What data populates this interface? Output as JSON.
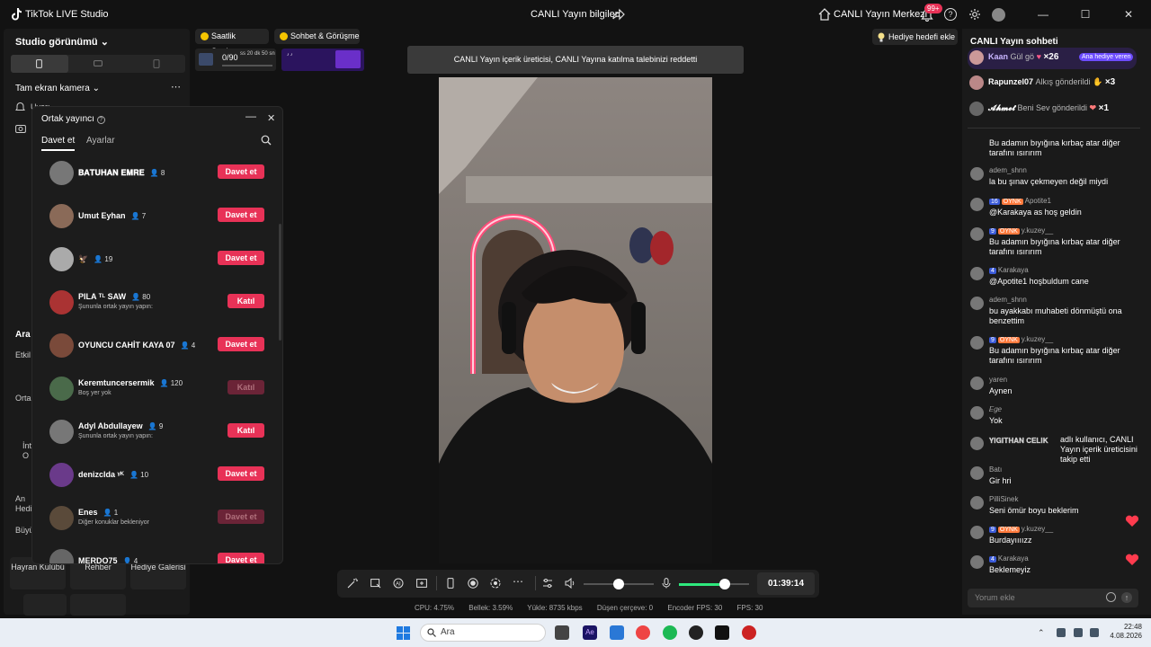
{
  "titlebar": {
    "app_title": "TikTok LIVE Studio",
    "center_title": "CANLI Yayın bilgileri",
    "live_center": "CANLI Yayın Merkezi",
    "notif_badge": "99+"
  },
  "left": {
    "studio_view": "Studio görünümü",
    "camera": "Tam ekran kamera",
    "hidden_row": "Uyarı",
    "label_ara": "Ara",
    "label_etkil": "Etkil",
    "label_orta": "Orta",
    "label_int": "İnt\nO",
    "label_an": "An\nHedi",
    "label_buy": "Büyü",
    "buttons": [
      "Hayran Kulübü",
      "Rehber",
      "Hediye Galerisi"
    ]
  },
  "cohost": {
    "title": "Ortak yayıncı",
    "tab_invite": "Davet et",
    "tab_settings": "Ayarlar",
    "rows": [
      {
        "name": "𝐁𝐀𝐓𝐔𝐇𝐀𝐍 𝐄𝐌𝐑𝐄",
        "count": "8",
        "sub": "",
        "button": "Davet et",
        "kind": "invite",
        "disabled": false
      },
      {
        "name": "Umut Eyhan",
        "count": "7",
        "sub": "",
        "button": "Davet et",
        "kind": "invite",
        "disabled": false
      },
      {
        "name": "🦅",
        "count": "19",
        "sub": "",
        "button": "Davet et",
        "kind": "invite",
        "disabled": false
      },
      {
        "name": "PILA ᵀᴸ SAW",
        "count": "80",
        "sub": "Şununla ortak yayın yapın:",
        "button": "Katıl",
        "kind": "join",
        "disabled": false
      },
      {
        "name": "OYUNCU CAHİT KAYA 07",
        "count": "4",
        "sub": "",
        "button": "Davet et",
        "kind": "invite",
        "disabled": false
      },
      {
        "name": "Keremtuncersermik",
        "count": "120",
        "sub": "Boş yer yok",
        "button": "Katıl",
        "kind": "join",
        "disabled": true
      },
      {
        "name": "Adyl Abdullayew",
        "count": "9",
        "sub": "Şununla ortak yayın yapın:",
        "button": "Katıl",
        "kind": "join",
        "disabled": false
      },
      {
        "name": "denizclda ᵞᴷ",
        "count": "10",
        "sub": "",
        "button": "Davet et",
        "kind": "invite",
        "disabled": false
      },
      {
        "name": "Enes",
        "count": "1",
        "sub": "Diğer konuklar bekleniyor",
        "button": "Davet et",
        "kind": "invite",
        "disabled": true
      },
      {
        "name": "MERDO75",
        "count": "4",
        "sub": "",
        "button": "Davet et",
        "kind": "invite",
        "disabled": false
      }
    ]
  },
  "top": {
    "chip_ranking": "Saatlik Sıralama",
    "chip_chat": "Sohbet & Görüşme",
    "progress_text": "0/90",
    "progress_time": "ss 20 dk 50 sn",
    "notice": "CANLI Yayın içerik üreticisi, CANLI Yayına katılma talebinizi reddetti",
    "gift_goal": "Hediye hedefi ekle"
  },
  "controls": {
    "timer": "01:39:14",
    "volume_level": 0.5,
    "mic_level": 0.65
  },
  "stats": {
    "cpu": "CPU:  4.75%",
    "memory": "Bellek:  3.59%",
    "upload": "Yükle:  8735 kbps",
    "dropped": "Düşen çerçeve:  0",
    "encoder": "Encoder FPS:  30",
    "fps": "FPS:  30"
  },
  "chat": {
    "title": "CANLI Yayın sohbeti",
    "gifts": [
      {
        "user": "Kaan",
        "action": "Gül gö",
        "mult": "×26",
        "tag": "Ana hediye veren"
      },
      {
        "user": "Rapunzel07",
        "action": "Alkış gönderildi",
        "mult": "×3"
      },
      {
        "user": "𝓐𝓱𝓶𝓮𝓽",
        "action": "Beni Sev gönderildi",
        "mult": "×1"
      }
    ],
    "messages": [
      {
        "user": "",
        "text": "Bu adamın bıyığına kırbaç atar diğer tarafını ısırırım"
      },
      {
        "user": "adem_shnn",
        "text": "la bu şınav çekmeyen değil miydi"
      },
      {
        "user": "Apotite1",
        "level": "16",
        "oynk": "OYNK",
        "text": "@Karakaya as hoş geldin"
      },
      {
        "user": "y.kuzey__",
        "level": "9",
        "oynk": "OYNK",
        "text": "Bu adamın bıyığına kırbaç atar diğer tarafını ısırırım"
      },
      {
        "user": "Karakaya",
        "level": "4",
        "text": "@Apotite1 hoşbuldum cane"
      },
      {
        "user": "adem_shnn",
        "text": "bu ayakkabı muhabeti dönmüştü ona benzettim"
      },
      {
        "user": "y.kuzey__",
        "level": "9",
        "oynk": "OYNK",
        "text": "Bu adamın bıyığına kırbaç atar diğer tarafını ısırırım"
      },
      {
        "user": "yaren",
        "text": "Aynen"
      },
      {
        "user": "𝐸𝑔𝑒",
        "text": "Yok"
      },
      {
        "user": "𝐘𝐈𝐆𝐈𝐓𝐇𝐀𝐍 𝐂𝐄𝐋𝐈𝐊",
        "text": "adlı kullanıcı, CANLI Yayın içerik üreticisini takip etti"
      },
      {
        "user": "Batı",
        "text": "Gir hri"
      },
      {
        "user": "PilliSinek",
        "text": "Seni ömür boyu beklerim"
      },
      {
        "user": "y.kuzey__",
        "level": "9",
        "oynk": "OYNK",
        "text": "Burdayıııızz"
      },
      {
        "user": "Karakaya",
        "level": "4",
        "text": "Beklemeyiz"
      }
    ],
    "comment_placeholder": "Yorum ekle"
  },
  "taskbar": {
    "search": "Ara",
    "time": "22:48",
    "date": "4.08.2026"
  }
}
